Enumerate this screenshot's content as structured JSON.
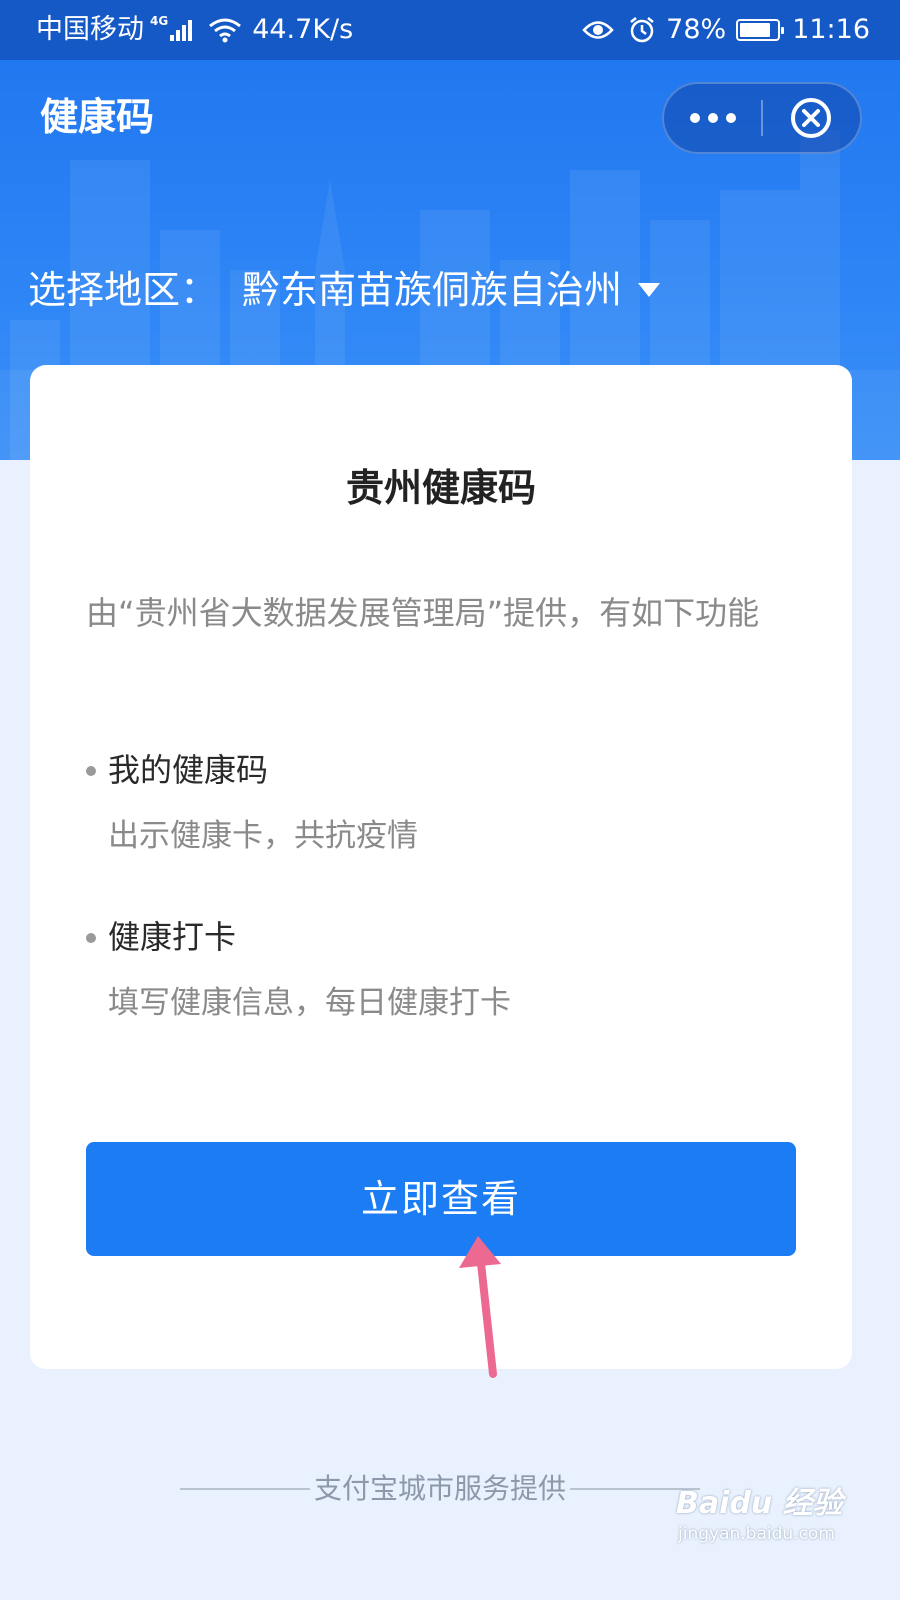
{
  "status_bar": {
    "carrier": "中国移动",
    "network": "4G",
    "speed": "44.7K/s",
    "battery": "78%",
    "battery_level": 0.78,
    "time": "11:16"
  },
  "header": {
    "title": "健康码",
    "more_icon": "more-dots-icon",
    "close_icon": "close-circle-icon"
  },
  "region": {
    "label": "选择地区：",
    "value": "黔东南苗族侗族自治州"
  },
  "card": {
    "title": "贵州健康码",
    "intro": "由“贵州省大数据发展管理局”提供，有如下功能",
    "features": [
      {
        "name": "我的健康码",
        "desc": "出示健康卡，共抗疫情"
      },
      {
        "name": "健康打卡",
        "desc": "填写健康信息，每日健康打卡"
      }
    ],
    "button": "立即查看"
  },
  "footer": {
    "text": "支付宝城市服务提供"
  },
  "watermark": {
    "brand": "Baidu 经验",
    "site": "jingyan.baidu.com"
  },
  "colors": {
    "primary": "#1b7cf3",
    "header_bg": "#1f74ee",
    "page_bg": "#e8f1fd",
    "annotation_arrow": "#ec6a92"
  }
}
